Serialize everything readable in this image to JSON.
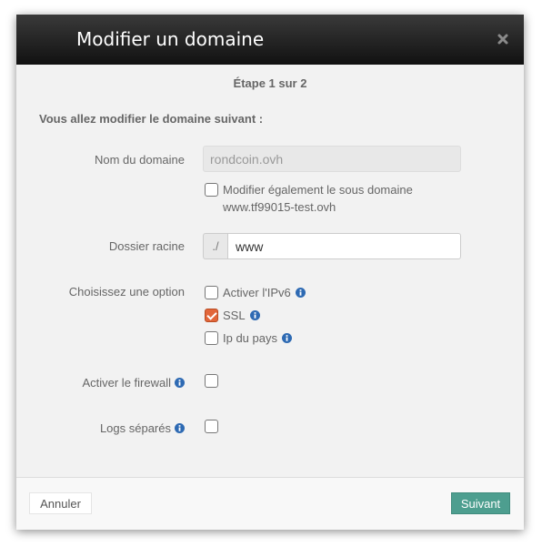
{
  "modal": {
    "title": "Modifier un domaine",
    "step": "Étape 1 sur 2",
    "intro": "Vous allez modifier le domaine suivant :"
  },
  "form": {
    "domain_label": "Nom du domaine",
    "domain_value": "rondcoin.ovh",
    "subdomain_checkbox": {
      "label": "Modifier également le sous domaine www.tf99015-test.ovh",
      "checked": false
    },
    "root_label": "Dossier racine",
    "root_prefix": "./",
    "root_value": "www",
    "options_label": "Choisissez une option",
    "options": [
      {
        "label": "Activer l'IPv6",
        "checked": false,
        "info_icon": "info-icon"
      },
      {
        "label": "SSL",
        "checked": true,
        "info_icon": "info-icon"
      },
      {
        "label": "Ip du pays",
        "checked": false,
        "info_icon": "info-icon"
      }
    ],
    "firewall_label": "Activer le firewall",
    "firewall_checked": false,
    "logs_label": "Logs séparés",
    "logs_checked": false
  },
  "footer": {
    "cancel_label": "Annuler",
    "next_label": "Suivant"
  },
  "colors": {
    "header_bg": "#111111",
    "next_button": "#4d9e8f",
    "checked_checkbox": "#e2663a",
    "info_icon": "#2e6ab3"
  }
}
